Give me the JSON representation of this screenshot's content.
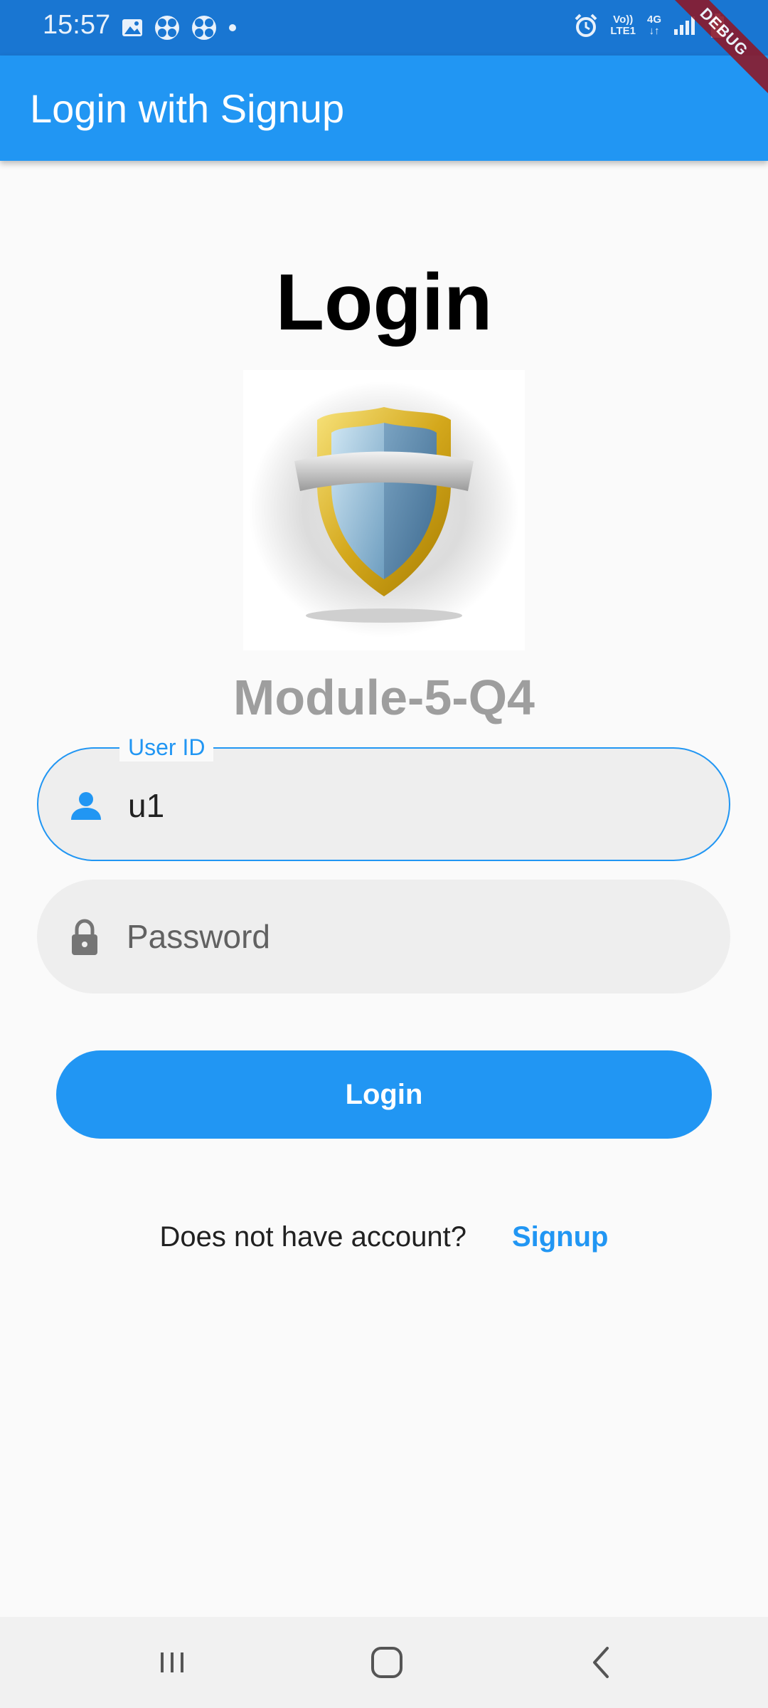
{
  "status_bar": {
    "time": "15:57",
    "left_icons": [
      "gallery-icon",
      "fan-icon",
      "fan-icon",
      "dot-icon"
    ],
    "network_top": "Vo))",
    "network_bottom": "LTE1",
    "data_top": "4G",
    "data_bottom": "↓↑"
  },
  "debug_banner": "DEBUG",
  "app_bar": {
    "title": "Login with Signup"
  },
  "main": {
    "heading": "Login",
    "logo": "shield-logo",
    "module_label": "Module-5-Q4",
    "user_id_field": {
      "label": "User ID",
      "value": "u1",
      "icon": "person-icon"
    },
    "password_field": {
      "placeholder": "Password",
      "icon": "lock-icon"
    },
    "login_button_label": "Login",
    "signup_prompt": "Does not have account?",
    "signup_link": "Signup"
  },
  "colors": {
    "primary": "#2196f3",
    "status_bar": "#1976d2",
    "field_fill": "#eeeeee",
    "module_text": "#9e9e9e"
  },
  "nav_bar": {
    "buttons": [
      "recents-icon",
      "home-icon",
      "back-icon"
    ]
  }
}
